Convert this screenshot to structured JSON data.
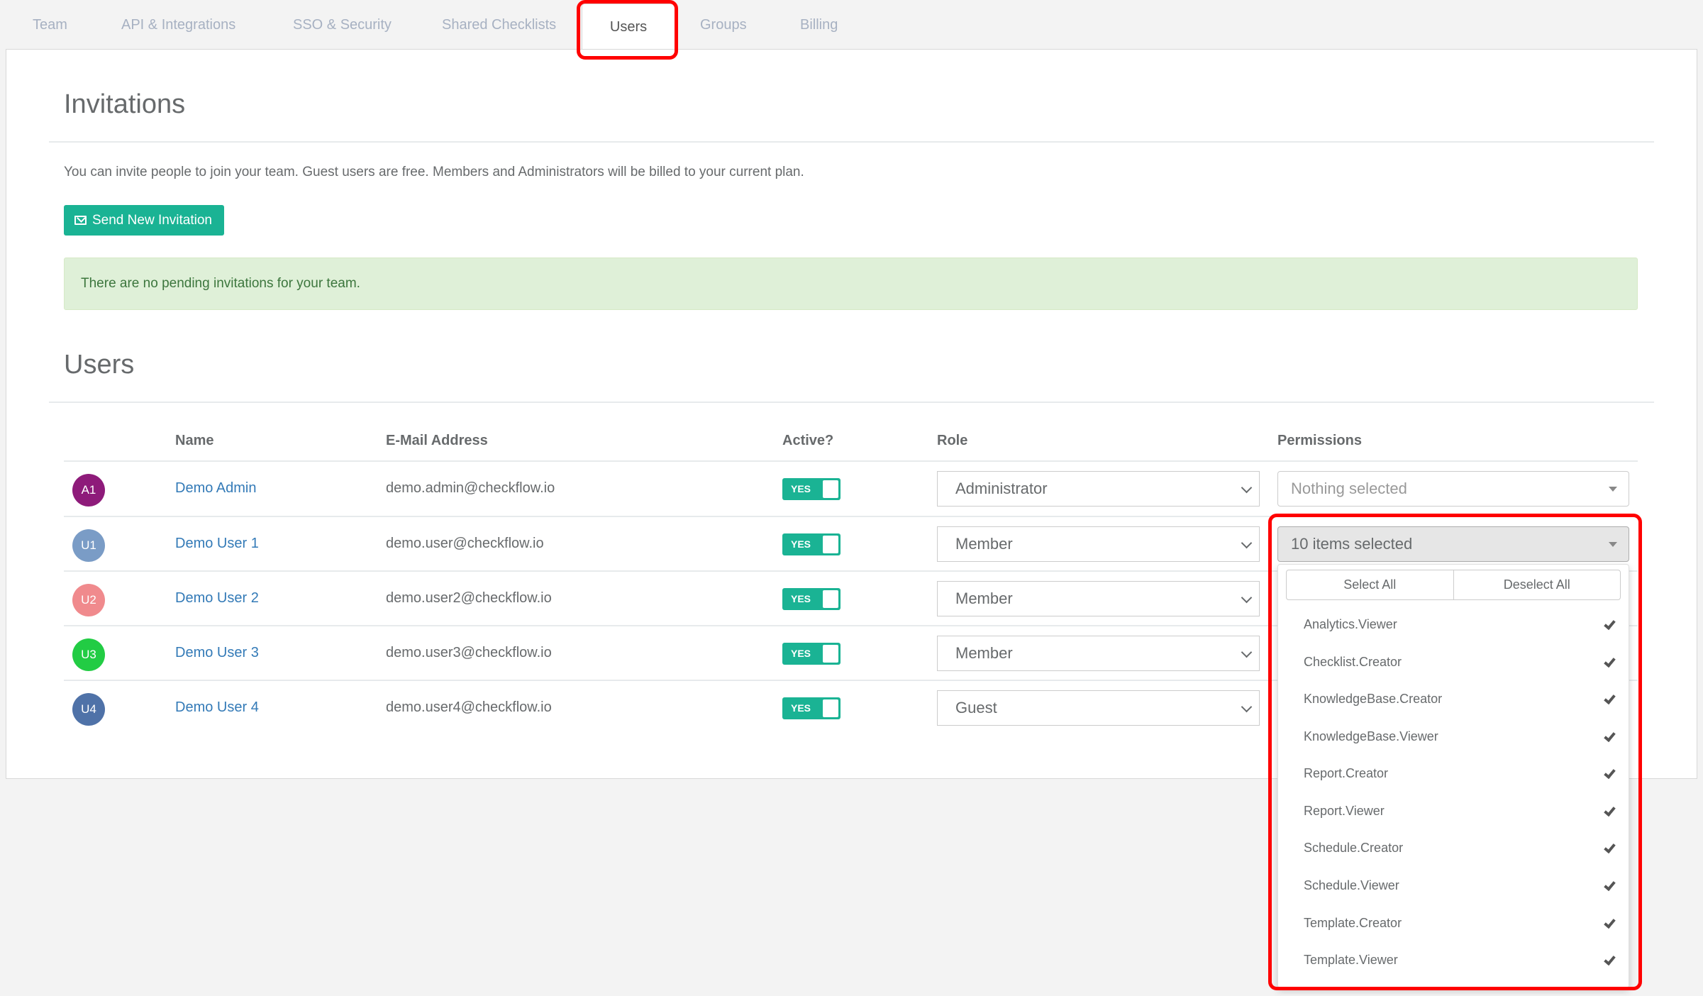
{
  "tabs": [
    {
      "label": "Team",
      "active": false
    },
    {
      "label": "API & Integrations",
      "active": false
    },
    {
      "label": "SSO & Security",
      "active": false
    },
    {
      "label": "Shared Checklists",
      "active": false
    },
    {
      "label": "Users",
      "active": true
    },
    {
      "label": "Groups",
      "active": false
    },
    {
      "label": "Billing",
      "active": false
    }
  ],
  "invitations": {
    "title": "Invitations",
    "description": "You can invite people to join your team. Guest users are free. Members and Administrators will be billed to your current plan.",
    "send_button": "Send New Invitation",
    "send_button_icon": "envelope-icon",
    "empty_alert": "There are no pending invitations for your team."
  },
  "users": {
    "title": "Users",
    "columns": {
      "name": "Name",
      "email": "E-Mail Address",
      "active": "Active?",
      "role": "Role",
      "permissions": "Permissions"
    },
    "rows": [
      {
        "initials": "A1",
        "avatar_color": "#8e1b7a",
        "name": "Demo Admin",
        "email": "demo.admin@checkflow.io",
        "active": "YES",
        "role": "Administrator",
        "permissions": "Nothing selected"
      },
      {
        "initials": "U1",
        "avatar_color": "#7a9cc6",
        "name": "Demo User 1",
        "email": "demo.user@checkflow.io",
        "active": "YES",
        "role": "Member",
        "permissions": "10 items selected"
      },
      {
        "initials": "U2",
        "avatar_color": "#f08a8d",
        "name": "Demo User 2",
        "email": "demo.user2@checkflow.io",
        "active": "YES",
        "role": "Member",
        "permissions": ""
      },
      {
        "initials": "U3",
        "avatar_color": "#22cc44",
        "name": "Demo User 3",
        "email": "demo.user3@checkflow.io",
        "active": "YES",
        "role": "Member",
        "permissions": ""
      },
      {
        "initials": "U4",
        "avatar_color": "#4f72a8",
        "name": "Demo User 4",
        "email": "demo.user4@checkflow.io",
        "active": "YES",
        "role": "Guest",
        "permissions": ""
      }
    ]
  },
  "permissions_dropdown": {
    "select_all": "Select All",
    "deselect_all": "Deselect All",
    "options": [
      {
        "label": "Analytics.Viewer",
        "checked": true
      },
      {
        "label": "Checklist.Creator",
        "checked": true
      },
      {
        "label": "KnowledgeBase.Creator",
        "checked": true
      },
      {
        "label": "KnowledgeBase.Viewer",
        "checked": true
      },
      {
        "label": "Report.Creator",
        "checked": true
      },
      {
        "label": "Report.Viewer",
        "checked": true
      },
      {
        "label": "Schedule.Creator",
        "checked": true
      },
      {
        "label": "Schedule.Viewer",
        "checked": true
      },
      {
        "label": "Template.Creator",
        "checked": true
      },
      {
        "label": "Template.Viewer",
        "checked": true
      }
    ]
  },
  "colors": {
    "primary": "#1ab394",
    "link": "#337ab7",
    "highlight": "#ff0000",
    "alert_bg": "#dff0d8"
  }
}
